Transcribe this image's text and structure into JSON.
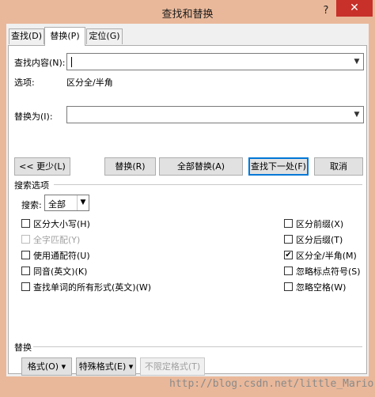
{
  "window": {
    "title": "查找和替换",
    "help": "?",
    "close": "✕"
  },
  "tabs": [
    {
      "label": "查找(D)",
      "active": false
    },
    {
      "label": "替换(P)",
      "active": true
    },
    {
      "label": "定位(G)",
      "active": false
    }
  ],
  "find": {
    "label": "查找内容(N):",
    "value": ""
  },
  "options": {
    "label": "选项:",
    "value": "区分全/半角"
  },
  "replace": {
    "label": "替换为(I):",
    "value": ""
  },
  "buttons": {
    "less": "<< 更少(L)",
    "replace": "替换(R)",
    "replace_all": "全部替换(A)",
    "find_next": "查找下一处(F)",
    "cancel": "取消"
  },
  "search_options": {
    "heading": "搜索选项",
    "search_label": "搜索:",
    "search_value": "全部",
    "left": [
      {
        "label": "区分大小写(H)",
        "checked": false,
        "disabled": false
      },
      {
        "label": "全字匹配(Y)",
        "checked": false,
        "disabled": true
      },
      {
        "label": "使用通配符(U)",
        "checked": false,
        "disabled": false
      },
      {
        "label": "同音(英文)(K)",
        "checked": false,
        "disabled": false
      },
      {
        "label": "查找单词的所有形式(英文)(W)",
        "checked": false,
        "disabled": false
      }
    ],
    "right": [
      {
        "label": "区分前缀(X)",
        "checked": false,
        "disabled": false
      },
      {
        "label": "区分后缀(T)",
        "checked": false,
        "disabled": false
      },
      {
        "label": "区分全/半角(M)",
        "checked": true,
        "disabled": false
      },
      {
        "label": "忽略标点符号(S)",
        "checked": false,
        "disabled": false
      },
      {
        "label": "忽略空格(W)",
        "checked": false,
        "disabled": false
      }
    ]
  },
  "replace_section": {
    "heading": "替换",
    "format": "格式(O) ▾",
    "special": "特殊格式(E) ▾",
    "no_format": "不限定格式(T)"
  },
  "watermark": "http://blog.csdn.net/little_Mario"
}
